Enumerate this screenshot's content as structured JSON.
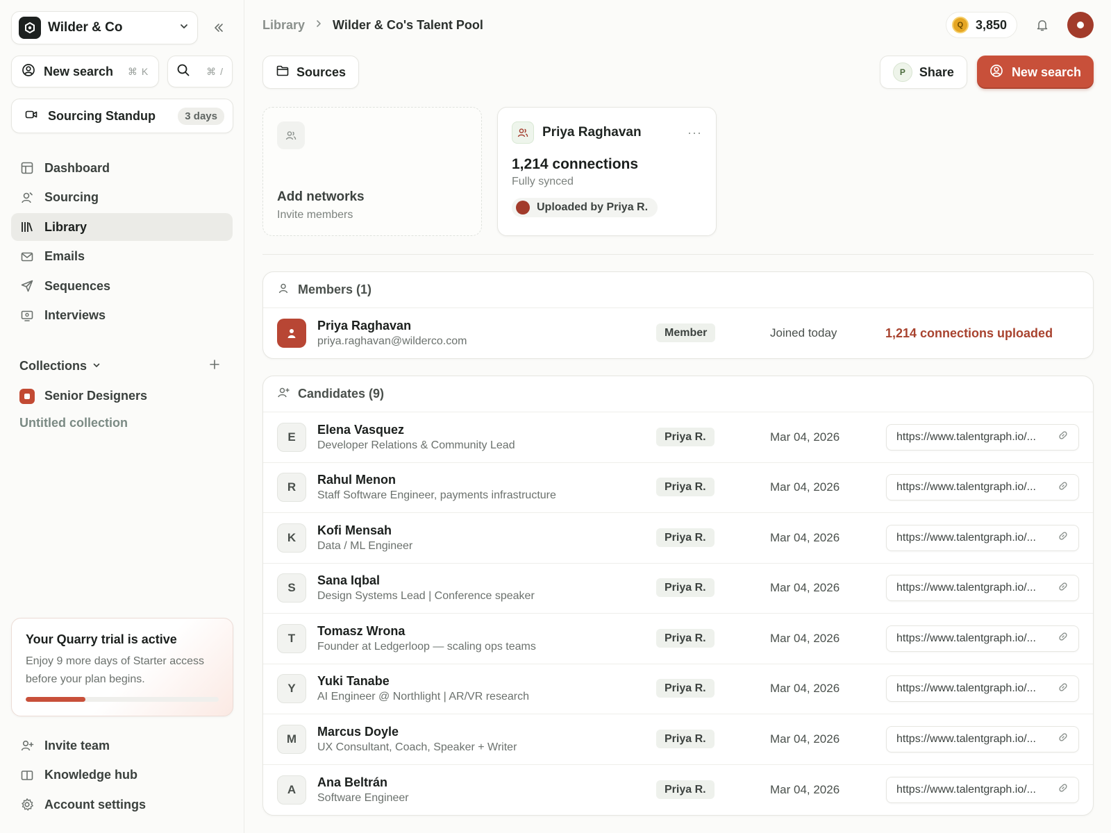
{
  "sidebar": {
    "org_name": "Wilder & Co",
    "quick_new_label": "New search",
    "quick_new_shortcut": "⌘ K",
    "quick_search_shortcut": "⌘ /",
    "standup_label": "Sourcing Standup",
    "standup_badge": "3 days",
    "nav": [
      {
        "label": "Dashboard",
        "icon": "dashboard-icon"
      },
      {
        "label": "Sourcing",
        "icon": "user-icon"
      },
      {
        "label": "Library",
        "icon": "library-icon",
        "active": true
      },
      {
        "label": "Emails",
        "icon": "mail-icon"
      },
      {
        "label": "Sequences",
        "icon": "send-icon"
      },
      {
        "label": "Interviews",
        "icon": "monitor-icon"
      }
    ],
    "collections_label": "Collections",
    "collections": [
      {
        "label": "Senior Designers",
        "color": "#c24a33"
      }
    ],
    "untitled_collection": "Untitled collection",
    "trial": {
      "title": "Your Quarry trial is active",
      "description": "Enjoy 9 more days of Starter access before your plan begins.",
      "progress_percent": 31
    },
    "bottom_nav": [
      {
        "label": "Invite team",
        "icon": "user-plus-icon"
      },
      {
        "label": "Knowledge hub",
        "icon": "book-icon"
      },
      {
        "label": "Account settings",
        "icon": "gear-icon"
      }
    ]
  },
  "header": {
    "breadcrumb_root": "Library",
    "breadcrumb_current": "Wilder & Co's Talent Pool",
    "coin_letter": "Q",
    "credits": "3,850"
  },
  "actions": {
    "sources_label": "Sources",
    "share_initial": "P",
    "share_label": "Share",
    "new_search_label": "New search"
  },
  "cards": {
    "add": {
      "title": "Add networks",
      "subtitle": "Invite members"
    },
    "network": {
      "name": "Priya Raghavan",
      "connections": "1,214 connections",
      "status": "Fully synced",
      "uploaded_by": "Uploaded by Priya R."
    }
  },
  "members": {
    "header": "Members (1)",
    "rows": [
      {
        "name": "Priya Raghavan",
        "email": "priya.raghavan@wilderco.com",
        "role": "Member",
        "joined": "Joined today",
        "uploaded": "1,214 connections uploaded"
      }
    ]
  },
  "candidates": {
    "header": "Candidates (9)",
    "rows": [
      {
        "initial": "E",
        "name": "Elena Vasquez",
        "title": "Developer Relations & Community Lead",
        "owner": "Priya R.",
        "date": "Mar 04, 2026",
        "url": "https://www.talentgraph.io/..."
      },
      {
        "initial": "R",
        "name": "Rahul Menon",
        "title": "Staff Software Engineer, payments infrastructure",
        "owner": "Priya R.",
        "date": "Mar 04, 2026",
        "url": "https://www.talentgraph.io/..."
      },
      {
        "initial": "K",
        "name": "Kofi Mensah",
        "title": "Data / ML Engineer",
        "owner": "Priya R.",
        "date": "Mar 04, 2026",
        "url": "https://www.talentgraph.io/..."
      },
      {
        "initial": "S",
        "name": "Sana Iqbal",
        "title": "Design Systems Lead | Conference speaker",
        "owner": "Priya R.",
        "date": "Mar 04, 2026",
        "url": "https://www.talentgraph.io/..."
      },
      {
        "initial": "T",
        "name": "Tomasz Wrona",
        "title": "Founder at Ledgerloop — scaling ops teams",
        "owner": "Priya R.",
        "date": "Mar 04, 2026",
        "url": "https://www.talentgraph.io/..."
      },
      {
        "initial": "Y",
        "name": "Yuki Tanabe",
        "title": "AI Engineer @ Northlight | AR/VR research",
        "owner": "Priya R.",
        "date": "Mar 04, 2026",
        "url": "https://www.talentgraph.io/..."
      },
      {
        "initial": "M",
        "name": "Marcus Doyle",
        "title": "UX Consultant, Coach, Speaker + Writer",
        "owner": "Priya R.",
        "date": "Mar 04, 2026",
        "url": "https://www.talentgraph.io/..."
      },
      {
        "initial": "A",
        "name": "Ana Beltrán",
        "title": "Software Engineer",
        "owner": "Priya R.",
        "date": "Mar 04, 2026",
        "url": "https://www.talentgraph.io/..."
      }
    ]
  },
  "colors": {
    "accent": "#c8503a",
    "accent_text": "#a8432f",
    "avatar": "#a23b2b"
  }
}
